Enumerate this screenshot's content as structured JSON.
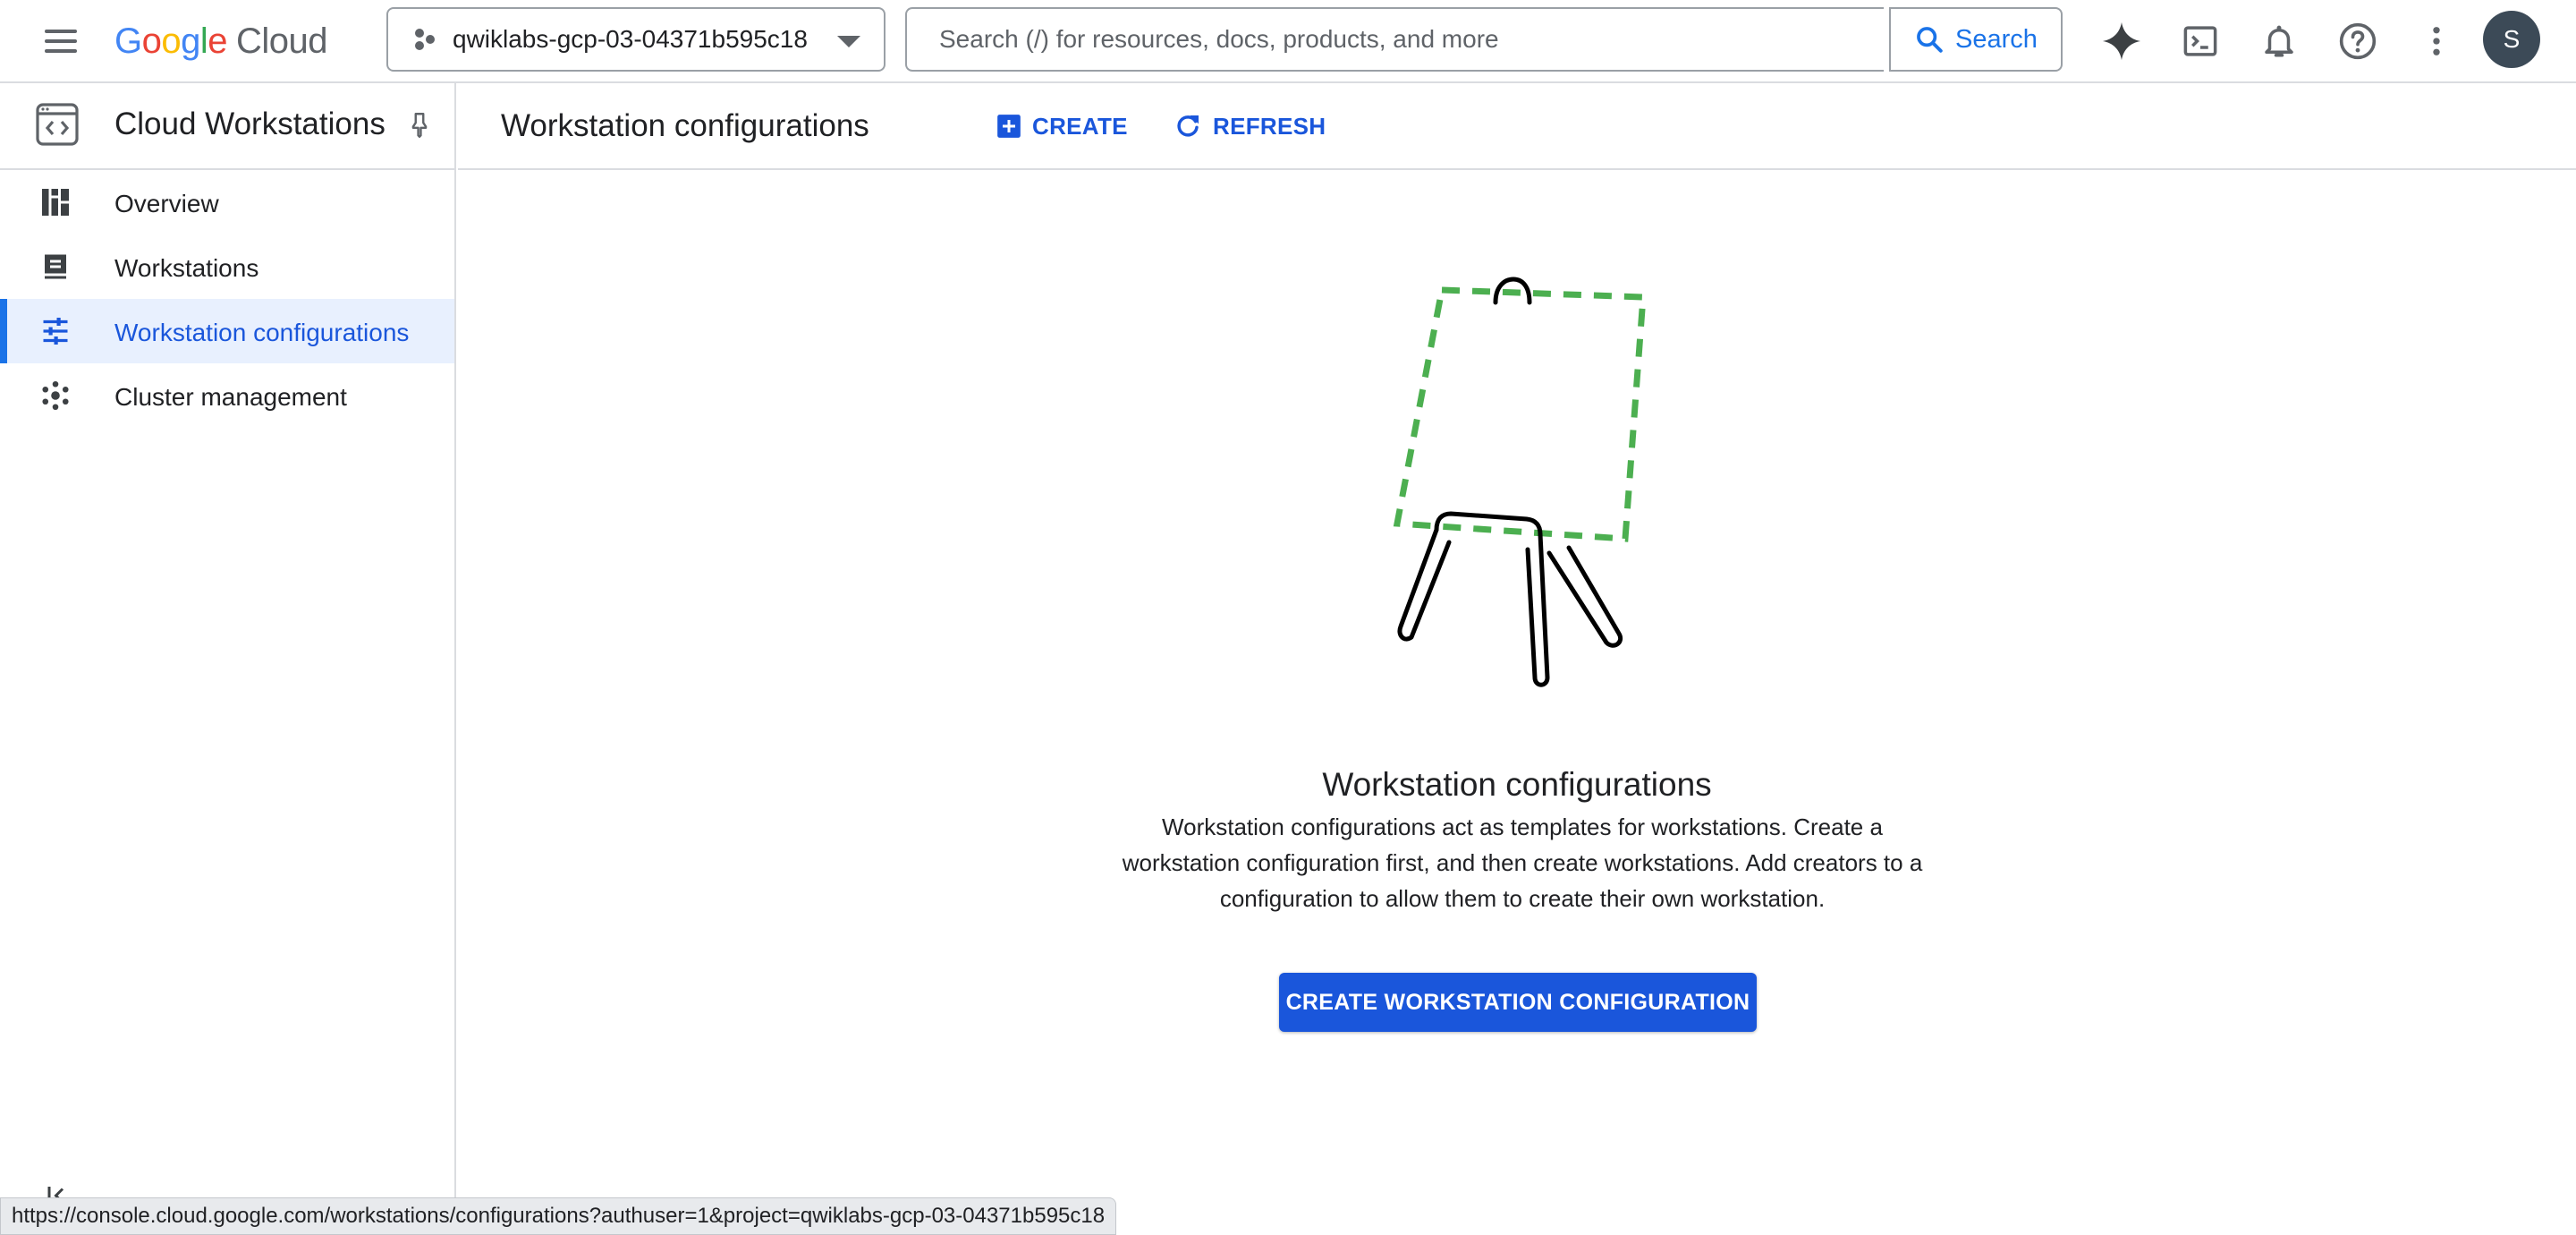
{
  "topbar": {
    "logo_letters": [
      "G",
      "o",
      "o",
      "g",
      "l",
      "e"
    ],
    "logo_cloud": "Cloud",
    "project_name": "qwiklabs-gcp-03-04371b595c18",
    "search_placeholder": "Search (/) for resources, docs, products, and more",
    "search_button": "Search",
    "icons": [
      "gemini-sparkle-icon",
      "cloud-shell-icon",
      "notifications-bell-icon",
      "help-icon",
      "more-vert-icon"
    ],
    "avatar_initial": "S"
  },
  "sidebar": {
    "product_title": "Cloud Workstations",
    "items": [
      {
        "label": "Overview",
        "icon": "dashboard-icon",
        "active": false
      },
      {
        "label": "Workstations",
        "icon": "workstation-icon",
        "active": false
      },
      {
        "label": "Workstation configurations",
        "icon": "tune-icon",
        "active": true
      },
      {
        "label": "Cluster management",
        "icon": "cluster-icon",
        "active": false
      }
    ]
  },
  "main": {
    "page_title": "Workstation configurations",
    "create_label": "CREATE",
    "refresh_label": "REFRESH",
    "empty_state": {
      "title": "Workstation configurations",
      "description": "Workstation configurations act as templates for workstations. Create a workstation configuration first, and then create workstations. Add creators to a configuration to allow them to create their own workstation.",
      "button_label": "CREATE WORKSTATION CONFIGURATION"
    }
  },
  "statusbar": {
    "url": "https://console.cloud.google.com/workstations/configurations?authuser=1&project=qwiklabs-gcp-03-04371b595c18"
  },
  "colors": {
    "accent": "#1a56db",
    "active_nav_bg": "#e8f0fe",
    "easel_dash": "#4caf50",
    "avatar_bg": "#3c4a57"
  }
}
